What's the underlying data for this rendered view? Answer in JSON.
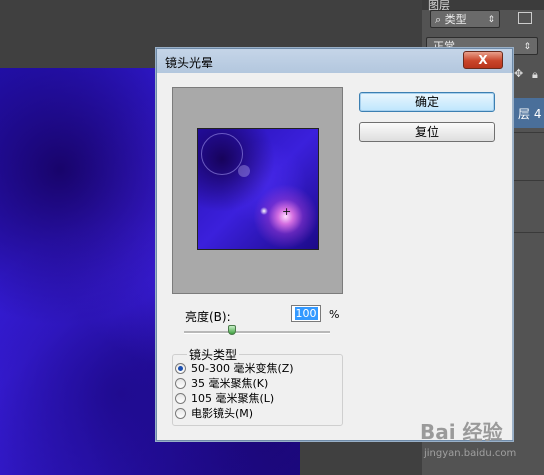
{
  "photoshop": {
    "panel_tab": "图层",
    "layer_filter_label": "类型",
    "blend_mode": "正常",
    "layer_name_fragment": "层 4"
  },
  "dialog": {
    "title": "镜头光晕",
    "close_label": "X",
    "ok_label": "确定",
    "reset_label": "复位",
    "brightness_label": "亮度(B):",
    "brightness_value": "100",
    "brightness_unit": "%",
    "brightness_slider_value_percent": 100,
    "lens_type_label": "镜头类型",
    "lens_types": [
      {
        "label": "50-300 毫米变焦(Z)",
        "checked": true
      },
      {
        "label": "35 毫米聚焦(K)",
        "checked": false
      },
      {
        "label": "105 毫米聚焦(L)",
        "checked": false
      },
      {
        "label": "电影镜头(M)",
        "checked": false
      }
    ],
    "crosshair_glyph": "+"
  },
  "watermark": {
    "text": "Bai 经验",
    "url": "jingyan.baidu.com"
  },
  "colors": {
    "canvas_purple": "#3a1fe0",
    "dialog_bg": "#f0f0f0",
    "close_red": "#c9452a",
    "selected_layer": "#4a6f9a"
  }
}
